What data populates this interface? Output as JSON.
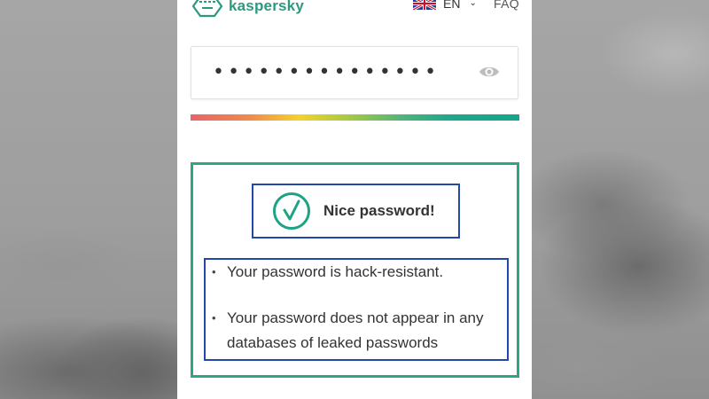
{
  "header": {
    "logo_text": "kaspersky",
    "language": "EN",
    "faq_label": "FAQ"
  },
  "password_field": {
    "masked_value": "•••••••••••••••",
    "visibility_icon": "eye-icon"
  },
  "strength_meter": {
    "level": 1.0,
    "colors": [
      "#e8636a",
      "#f3d22d",
      "#a7c942",
      "#1fa88b"
    ]
  },
  "result": {
    "title": "Nice password!",
    "status_icon": "check-circle-icon",
    "items": [
      {
        "text": "Your password is hack-resistant."
      },
      {
        "text": "Your password does not appear in any databases of leaked passwords"
      }
    ]
  },
  "colors": {
    "brand_green": "#2a9a7f",
    "frame_green": "#2fa585",
    "highlight_blue": "#2448a8"
  }
}
